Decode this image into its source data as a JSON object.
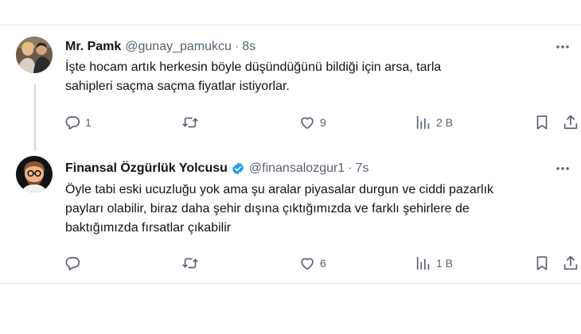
{
  "tweets": [
    {
      "author_name": "Mr. Pamk",
      "handle": "@gunay_pamukcu",
      "separator": "·",
      "time": "8s",
      "text_lines": [
        "İşte hocam artık herkesin böyle düşündüğünü bildiği için arsa, tarla",
        "sahipleri saçma saçma fiyatlar istiyorlar."
      ],
      "reply_count": "1",
      "retweet_count": "",
      "like_count": "9",
      "view_count": "2 B",
      "verified": false
    },
    {
      "author_name": "Finansal Özgürlük Yolcusu",
      "handle": "@finansalozgur1",
      "separator": "·",
      "time": "7s",
      "text_lines": [
        "Öyle tabi eski ucuzluğu yok ama şu aralar piyasalar durgun ve ciddi pazarlık",
        "payları olabilir, biraz daha şehir dışına çıktığımızda ve farklı şehirlere de",
        "baktığımızda fırsatlar çıkabilir"
      ],
      "reply_count": "",
      "retweet_count": "",
      "like_count": "6",
      "view_count": "1 B",
      "verified": true
    }
  ],
  "colors": {
    "text_primary": "#0f1419",
    "text_secondary": "#536471",
    "verified_badge": "#1d9bf0",
    "divider": "#e4e6e8",
    "thread_line": "#cfd9de"
  },
  "icons": {
    "reply": "reply-bubble-icon",
    "retweet": "retweet-arrows-icon",
    "like": "heart-icon",
    "views": "views-bars-icon",
    "bookmark": "bookmark-icon",
    "share": "share-upload-icon",
    "more": "more-dots-icon",
    "verified": "verified-badge-icon"
  }
}
